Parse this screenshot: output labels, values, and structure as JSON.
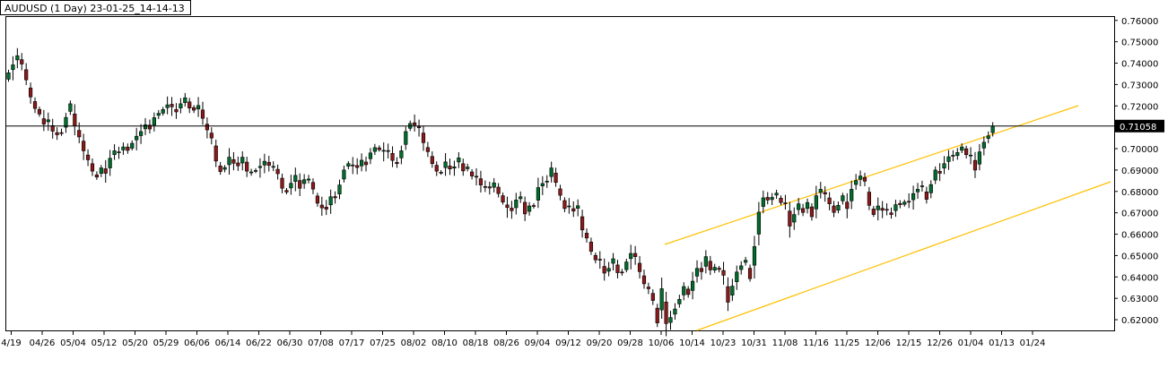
{
  "window": {
    "title": "AUDUSD (1 Day) 23-01-25_14-14-13"
  },
  "chart_data": {
    "type": "candlestick",
    "symbol": "AUDUSD",
    "timeframe": "1 Day",
    "ylim": [
      0.615,
      0.762
    ],
    "y_ticks": [
      "0.76000",
      "0.75000",
      "0.74000",
      "0.73000",
      "0.72000",
      "0.71000",
      "0.70000",
      "0.69000",
      "0.68000",
      "0.67000",
      "0.66000",
      "0.65000",
      "0.64000",
      "0.63000",
      "0.62000"
    ],
    "x_ticks": [
      "4/19",
      "04/26",
      "05/04",
      "05/12",
      "05/20",
      "05/29",
      "06/06",
      "06/14",
      "06/22",
      "06/30",
      "07/08",
      "07/17",
      "07/25",
      "08/02",
      "08/10",
      "08/18",
      "08/26",
      "09/04",
      "09/12",
      "09/20",
      "09/28",
      "10/06",
      "10/14",
      "10/23",
      "10/31",
      "11/08",
      "11/16",
      "11/25",
      "12/06",
      "12/15",
      "12/26",
      "01/04",
      "01/13",
      "01/24"
    ],
    "current_price": {
      "value": 0.71058,
      "label": "0.71058"
    },
    "closes": [
      0.7355,
      0.7392,
      0.7435,
      0.7396,
      0.7322,
      0.7242,
      0.7188,
      0.7162,
      0.7115,
      0.7135,
      0.7082,
      0.7065,
      0.7075,
      0.7146,
      0.721,
      0.7106,
      0.7055,
      0.699,
      0.6948,
      0.6895,
      0.6867,
      0.691,
      0.6885,
      0.6955,
      0.699,
      0.6985,
      0.7008,
      0.6992,
      0.7025,
      0.7058,
      0.708,
      0.7112,
      0.7092,
      0.7145,
      0.7165,
      0.7183,
      0.7205,
      0.7196,
      0.7172,
      0.721,
      0.7238,
      0.719,
      0.718,
      0.7202,
      0.7142,
      0.7088,
      0.705,
      0.6942,
      0.6893,
      0.6912,
      0.696,
      0.6932,
      0.692,
      0.696,
      0.6895,
      0.6891,
      0.6898,
      0.6917,
      0.6941,
      0.6922,
      0.6917,
      0.6883,
      0.6815,
      0.6797,
      0.6838,
      0.6875,
      0.6815,
      0.6855,
      0.6858,
      0.6811,
      0.6745,
      0.6723,
      0.6717,
      0.6775,
      0.677,
      0.683,
      0.69,
      0.693,
      0.6922,
      0.6912,
      0.6946,
      0.6925,
      0.698,
      0.7005,
      0.6995,
      0.6992,
      0.699,
      0.6945,
      0.693,
      0.699,
      0.708,
      0.7118,
      0.7111,
      0.7098,
      0.7028,
      0.6986,
      0.693,
      0.6895,
      0.6889,
      0.6938,
      0.6905,
      0.6915,
      0.6957,
      0.6896,
      0.6914,
      0.6872,
      0.6869,
      0.683,
      0.682,
      0.6816,
      0.684,
      0.679,
      0.675,
      0.6725,
      0.671,
      0.676,
      0.6775,
      0.6695,
      0.6732,
      0.673,
      0.6818,
      0.6837,
      0.6848,
      0.691,
      0.6842,
      0.6782,
      0.672,
      0.6732,
      0.6708,
      0.6733,
      0.662,
      0.6582,
      0.652,
      0.648,
      0.648,
      0.6418,
      0.644,
      0.6485,
      0.642,
      0.642,
      0.647,
      0.651,
      0.6495,
      0.6425,
      0.6368,
      0.6345,
      0.629,
      0.6185,
      0.6345,
      0.6182,
      0.621,
      0.625,
      0.6295,
      0.6355,
      0.6318,
      0.638,
      0.644,
      0.6425,
      0.6495,
      0.6433,
      0.6445,
      0.6435,
      0.6408,
      0.6282,
      0.6357,
      0.6423,
      0.6452,
      0.6478,
      0.6392,
      0.6542,
      0.6703,
      0.677,
      0.676,
      0.6772,
      0.6792,
      0.6748,
      0.6745,
      0.6638,
      0.6692,
      0.6742,
      0.6702,
      0.6748,
      0.6682,
      0.678,
      0.681,
      0.6788,
      0.6742,
      0.6702,
      0.6735,
      0.678,
      0.672,
      0.681,
      0.6851,
      0.6872,
      0.6848,
      0.6735,
      0.6692,
      0.6732,
      0.6712,
      0.6715,
      0.6692,
      0.6738,
      0.6738,
      0.675,
      0.6752,
      0.679,
      0.681,
      0.6826,
      0.6763,
      0.6832,
      0.69,
      0.6885,
      0.693,
      0.6962,
      0.6969,
      0.6982,
      0.7008,
      0.6972,
      0.697,
      0.69,
      0.6985,
      0.703,
      0.706,
      0.7105
    ]
  }
}
